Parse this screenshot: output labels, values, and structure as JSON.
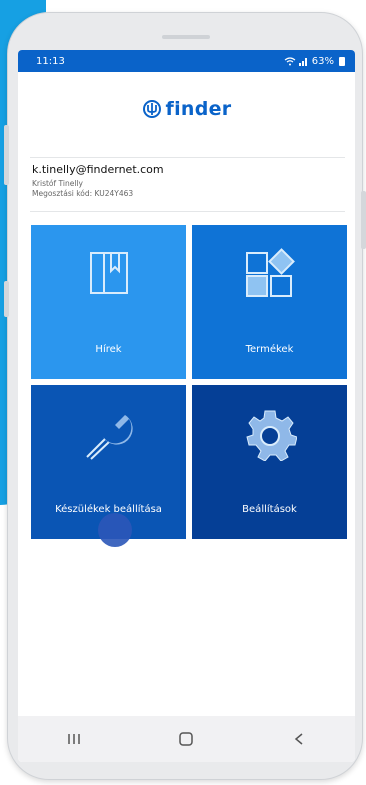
{
  "status_bar": {
    "time": "11:13",
    "battery": "63%",
    "background_color": "#0a63c9"
  },
  "app": {
    "logo_text": "finder",
    "brand_color": "#0a63c9"
  },
  "user": {
    "email": "k.tinelly@findernet.com",
    "name": "Kristóf Tinelly",
    "share_code": "Megosztási kód: KU24Y463"
  },
  "tiles": [
    {
      "label": "Hírek",
      "icon": "book-icon",
      "color": "#2b96ee"
    },
    {
      "label": "Termékek",
      "icon": "products-icon",
      "color": "#0f73d6"
    },
    {
      "label": "Készülékek beállítása",
      "icon": "wrench-icon",
      "color": "#0a55b4"
    },
    {
      "label": "Beállítások",
      "icon": "gear-icon",
      "color": "#053f96"
    }
  ],
  "navbar": {
    "recent": "recent-apps-icon",
    "home": "home-icon",
    "back": "back-icon"
  }
}
